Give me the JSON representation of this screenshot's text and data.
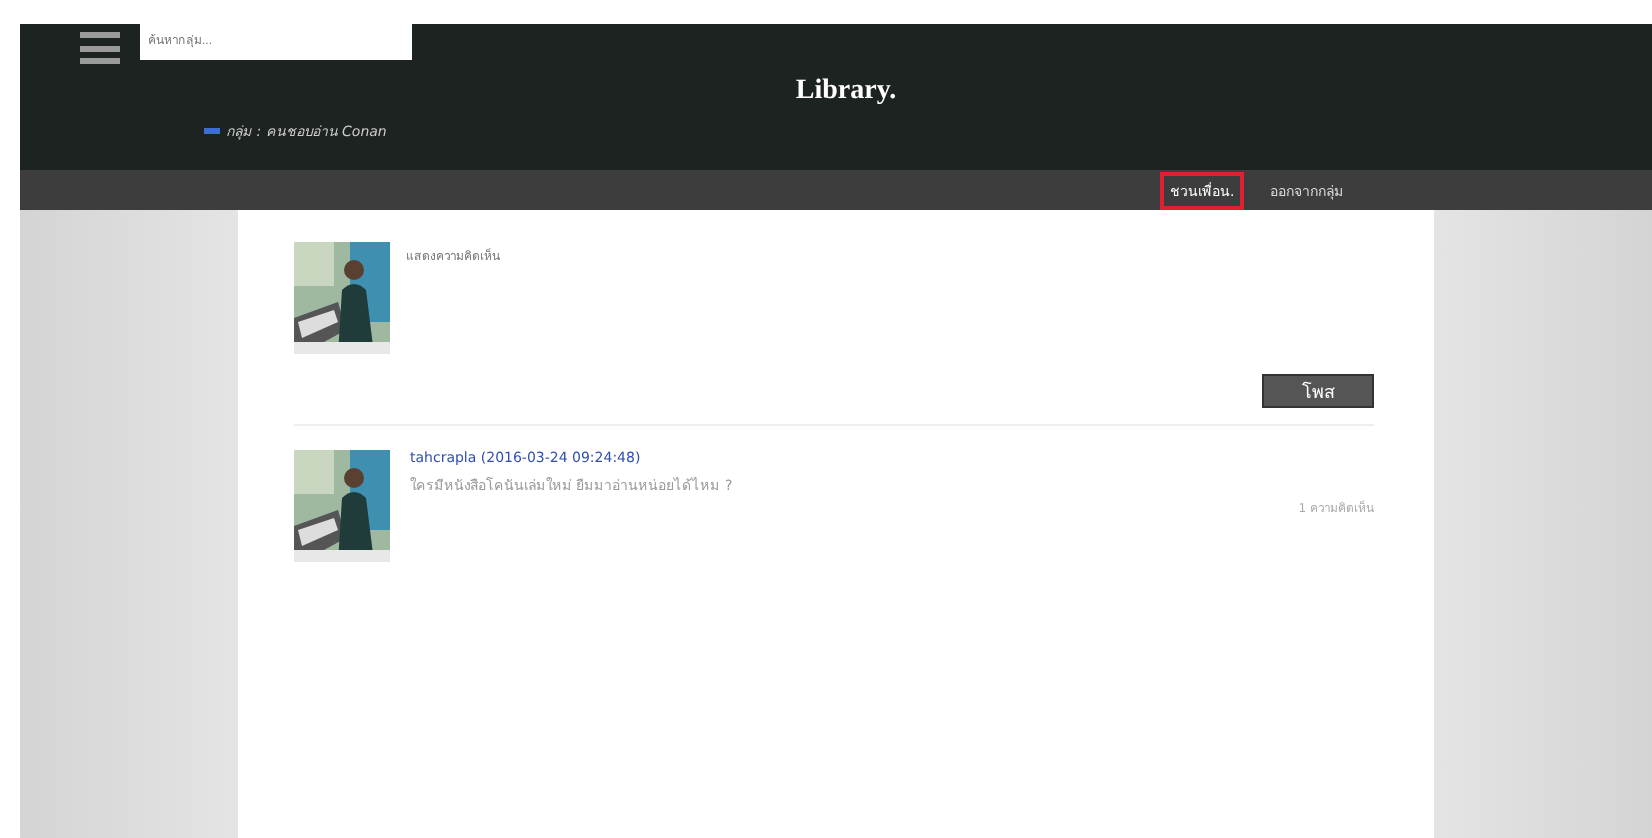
{
  "header": {
    "search": {
      "placeholder": "ค้นหากลุ่ม..."
    },
    "title": "Library.",
    "breadcrumb": "กลุ่ม : คนชอบอ่าน Conan"
  },
  "group_actions": [
    {
      "label": "ชวนเพื่อน.",
      "selected": true
    },
    {
      "label": "ออกจากกลุ่ม",
      "selected": false
    }
  ],
  "composer": {
    "placeholder": "แสดงความคิดเห็น",
    "post_button": "โพส"
  },
  "posts": [
    {
      "author": "tahcrapla (2016-03-24 09:24:48)",
      "text": "ใครมีหนังสือโคนันเล่มใหม่ ยืมมาอ่านหน่อยได้ไหม ?",
      "comments": "1 ความคิดเห็น"
    }
  ]
}
